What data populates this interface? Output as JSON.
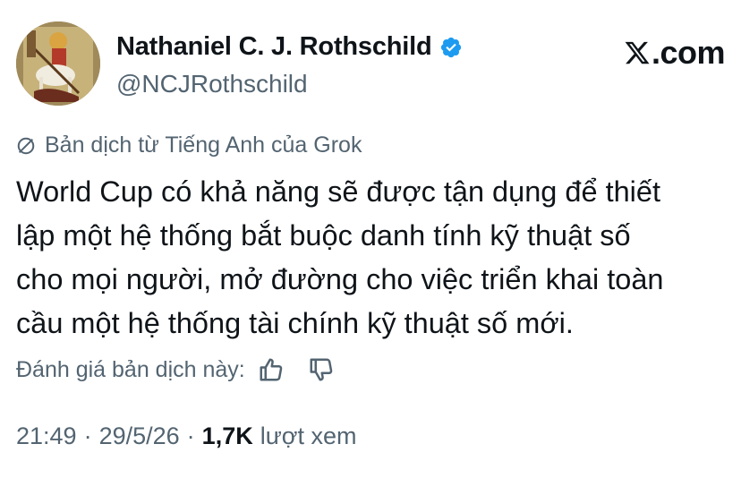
{
  "author": {
    "display_name": "Nathaniel C. J. Rothschild",
    "handle": "@NCJRothschild",
    "verified": true,
    "verified_color": "#1d9bf0"
  },
  "brand": {
    "text": ".com",
    "icon": "x-logo-icon"
  },
  "translation": {
    "label": "Bản dịch từ Tiếng Anh của Grok",
    "icon": "grok-icon"
  },
  "tweet": {
    "lines": [
      "World Cup có khả năng sẽ được tận dụng để thiết",
      "lập một hệ thống bắt buộc danh tính kỹ thuật số",
      "cho mọi người, mở đường cho việc triển khai toàn",
      "cầu một hệ thống tài chính kỹ thuật số mới."
    ]
  },
  "rating": {
    "label": "Đánh giá bản dịch này:",
    "up_icon": "thumbs-up-icon",
    "down_icon": "thumbs-down-icon"
  },
  "meta": {
    "time": "21:49",
    "separator": "·",
    "date": "29/5/26",
    "views_count": "1,7K",
    "views_label": "lượt xem"
  }
}
